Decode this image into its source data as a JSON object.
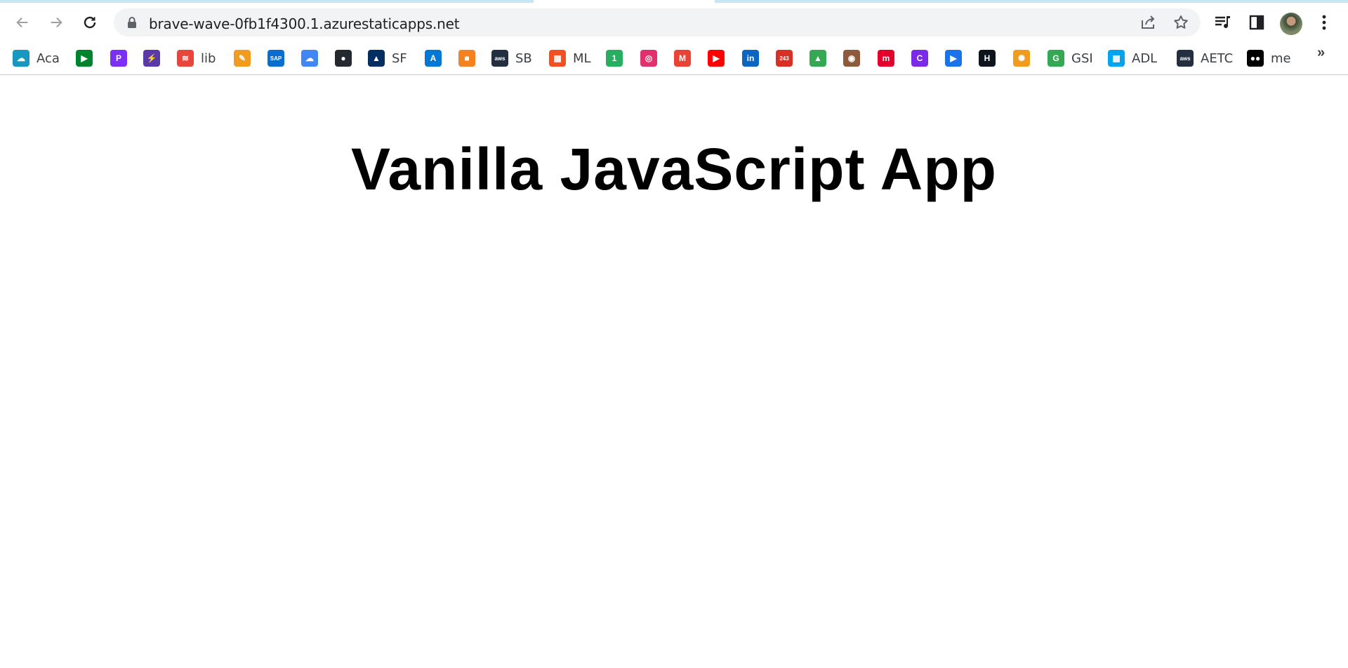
{
  "browser": {
    "url": "brave-wave-0fb1f4300.1.azurestaticapps.net",
    "nav": {
      "back_icon": "arrow-left-icon",
      "forward_icon": "arrow-right-icon",
      "reload_icon": "reload-icon"
    },
    "bookmarks": [
      {
        "label": "Aca",
        "icon": "salesforce-cloud",
        "color": "#1798c1"
      },
      {
        "label": "",
        "icon": "google-meet",
        "color": "#00832d"
      },
      {
        "label": "",
        "icon": "p-logo",
        "color": "#7b2ff7"
      },
      {
        "label": "",
        "icon": "bolt",
        "color": "#5a3aa8"
      },
      {
        "label": "lib",
        "icon": "lib-logo",
        "color": "#e8453c"
      },
      {
        "label": "",
        "icon": "pencil",
        "color": "#f29c1f"
      },
      {
        "label": "",
        "icon": "sap",
        "color": "#0a6ed1"
      },
      {
        "label": "",
        "icon": "google-cloud",
        "color": "#4285f4"
      },
      {
        "label": "",
        "icon": "github",
        "color": "#24292f"
      },
      {
        "label": "SF",
        "icon": "trailhead",
        "color": "#032e61"
      },
      {
        "label": "",
        "icon": "azure",
        "color": "#0078d4"
      },
      {
        "label": "",
        "icon": "box",
        "color": "#f58220"
      },
      {
        "label": "SB",
        "icon": "aws",
        "color": "#232f3e"
      },
      {
        "label": "ML",
        "icon": "microsoft",
        "color": "#f25022"
      },
      {
        "label": "",
        "icon": "circle-1",
        "color": "#27ae60"
      },
      {
        "label": "",
        "icon": "instagram",
        "color": "#e1306c"
      },
      {
        "label": "",
        "icon": "gmail",
        "color": "#ea4335"
      },
      {
        "label": "",
        "icon": "youtube",
        "color": "#ff0000"
      },
      {
        "label": "",
        "icon": "linkedin",
        "color": "#0a66c2"
      },
      {
        "label": "",
        "icon": "calendar-243",
        "color": "#d93025"
      },
      {
        "label": "",
        "icon": "google-drive",
        "color": "#34a853"
      },
      {
        "label": "",
        "icon": "cow",
        "color": "#8d5a3b"
      },
      {
        "label": "",
        "icon": "m-red",
        "color": "#e4002b"
      },
      {
        "label": "",
        "icon": "canva",
        "color": "#7d2ae8"
      },
      {
        "label": "",
        "icon": "play",
        "color": "#1a73e8"
      },
      {
        "label": "",
        "icon": "hackerrank",
        "color": "#0e141e"
      },
      {
        "label": "",
        "icon": "sun-bug",
        "color": "#f29c1f"
      },
      {
        "label": "GSI",
        "icon": "gsi",
        "color": "#34a853"
      },
      {
        "label": "ADL",
        "icon": "microsoft",
        "color": "#00a4ef"
      },
      {
        "label": "AETC",
        "icon": "aws",
        "color": "#232f3e"
      },
      {
        "label": "me",
        "icon": "medium",
        "color": "#000000"
      }
    ],
    "more_label": "»"
  },
  "page": {
    "title": "Vanilla JavaScript App"
  }
}
